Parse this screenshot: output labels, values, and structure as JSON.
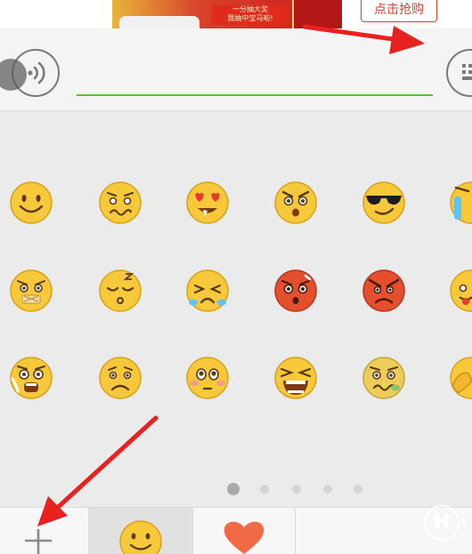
{
  "banner": {
    "prize_text": "一分抽大奖\n我抽中宝马啦!",
    "cta_label": "点击抢购"
  },
  "input": {
    "value": "",
    "placeholder": ""
  },
  "colors": {
    "input_underline": "#5fbc3f",
    "annotation_arrow": "#e8201f",
    "emoji_yellow": "#f7c83a",
    "angry_red": "#e4502e"
  },
  "emoji_grid": {
    "rows": [
      [
        "smile",
        "awkward",
        "heart-eyes",
        "surprised",
        "cool",
        "sweat"
      ],
      [
        "zip-mouth",
        "sleepy",
        "crying",
        "shocked",
        "angry",
        "tongue"
      ],
      [
        "scared",
        "sad",
        "blush",
        "screaming",
        "sick",
        "facepalm"
      ]
    ]
  },
  "pagination": {
    "page_count": 5,
    "active_index": 0
  },
  "tabs": [
    {
      "name": "add",
      "icon": "plus-icon",
      "selected": false
    },
    {
      "name": "emoji",
      "icon": "smiley-icon",
      "selected": true
    },
    {
      "name": "favorites",
      "icon": "heart-icon",
      "selected": false
    }
  ],
  "watermark": {
    "letter": "H",
    "tail": "\\"
  }
}
